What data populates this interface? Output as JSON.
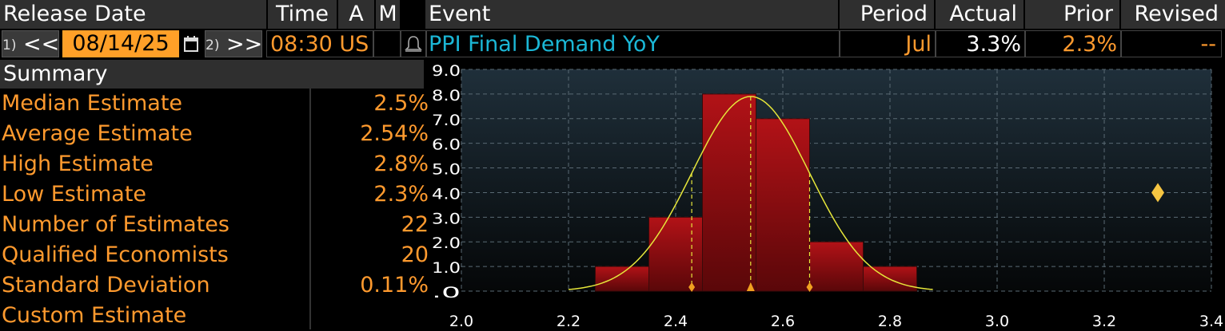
{
  "header": {
    "release_date": "Release Date",
    "time": "Time",
    "a": "A",
    "m": "M",
    "event": "Event",
    "period": "Period",
    "actual": "Actual",
    "prior": "Prior",
    "revised": "Revised"
  },
  "row": {
    "prev_key": "1)",
    "prev_label": "<<",
    "date": "08/14/25",
    "next_key": "2)",
    "next_label": ">>",
    "time": "08:30",
    "country": "US",
    "event": "PPI Final Demand YoY",
    "period": "Jul",
    "actual": "3.3%",
    "prior": "2.3%",
    "revised": "--"
  },
  "summary": {
    "title": "Summary",
    "rows": [
      {
        "label": "Median Estimate",
        "value": "2.5%"
      },
      {
        "label": "Average Estimate",
        "value": "2.54%"
      },
      {
        "label": "High Estimate",
        "value": "2.8%"
      },
      {
        "label": "Low Estimate",
        "value": "2.3%"
      },
      {
        "label": "Number of Estimates",
        "value": "22"
      },
      {
        "label": "Qualified Economists",
        "value": "20"
      },
      {
        "label": "Standard Deviation",
        "value": "0.11%"
      },
      {
        "label": "Custom Estimate",
        "value": ""
      }
    ]
  },
  "colors": {
    "accent_orange": "#ff9a2e",
    "event_cyan": "#1bb7d6",
    "bar_red": "#8a0d10",
    "curve_yellow": "#e6e63a",
    "marker_gold": "#f5c542"
  },
  "chart_data": {
    "type": "bar",
    "xlim": [
      2.0,
      3.4
    ],
    "ylim": [
      0,
      9
    ],
    "x_ticks": [
      "2.0",
      "2.2",
      "2.4",
      "2.6",
      "2.8",
      "3.0",
      "3.2",
      "3.4"
    ],
    "y_ticks": [
      ".0",
      "1.0",
      "2.0",
      "3.0",
      "4.0",
      "5.0",
      "6.0",
      "7.0",
      "8.0",
      "9.0"
    ],
    "bins": [
      {
        "from": 2.25,
        "to": 2.35,
        "count": 1
      },
      {
        "from": 2.35,
        "to": 2.45,
        "count": 3
      },
      {
        "from": 2.45,
        "to": 2.55,
        "count": 8
      },
      {
        "from": 2.55,
        "to": 2.65,
        "count": 7
      },
      {
        "from": 2.65,
        "to": 2.75,
        "count": 2
      },
      {
        "from": 2.75,
        "to": 2.85,
        "count": 1
      }
    ],
    "normal_curve": {
      "mean": 2.54,
      "sd": 0.11,
      "peak": 7.9,
      "from": 2.2,
      "to": 2.88
    },
    "dashed_markers": [
      2.43,
      2.54,
      2.65
    ],
    "actual_marker": {
      "x": 3.3,
      "y": 4.0
    },
    "grid": true
  }
}
